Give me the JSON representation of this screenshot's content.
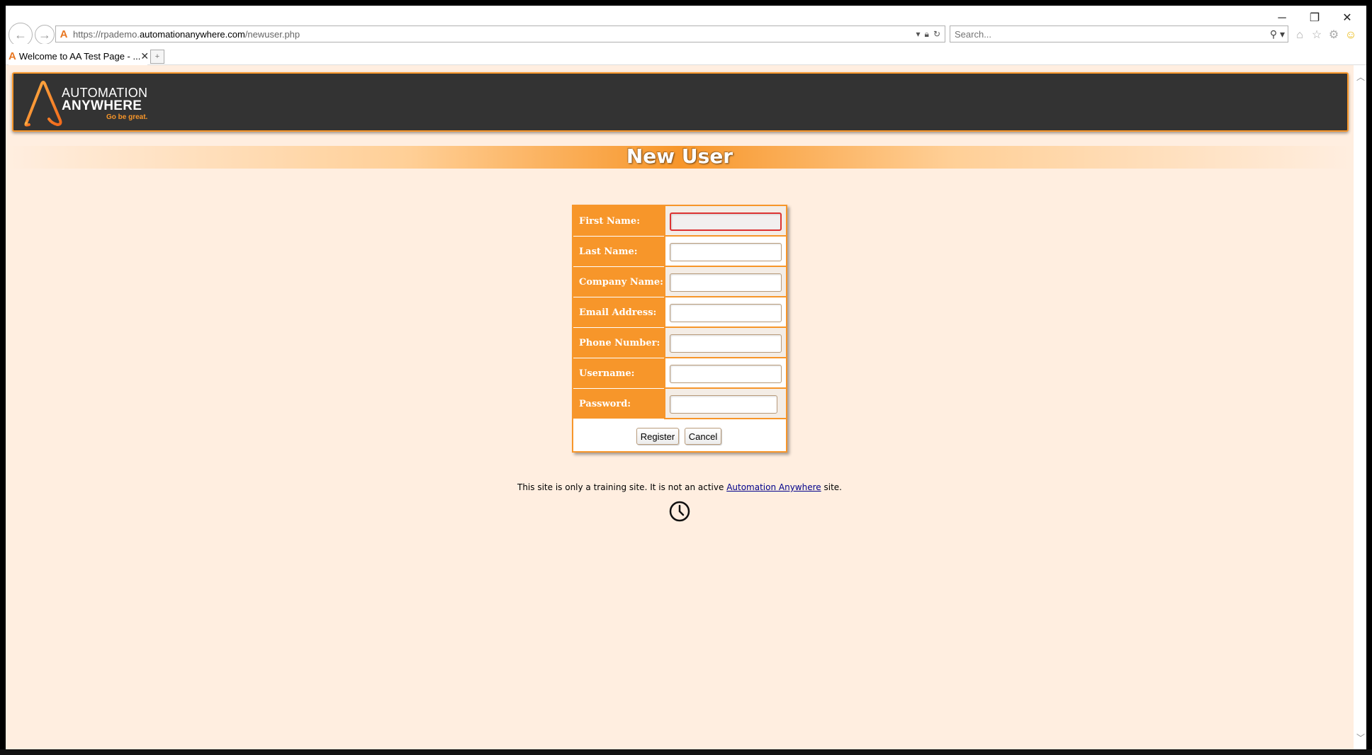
{
  "browser": {
    "url_prefix": "https://rpademo.",
    "url_domain": "automationanywhere.com",
    "url_path": "/newuser.php",
    "search_placeholder": "Search...",
    "tab_title": "Welcome to AA Test Page - ...",
    "tab_close": "✕",
    "minimize": "─",
    "restore": "❐",
    "close": "✕"
  },
  "header": {
    "logo_line1": "AUTOMATION",
    "logo_line2": "ANYWHERE",
    "logo_tagline": "Go be great."
  },
  "page": {
    "title": "New User"
  },
  "form": {
    "fields": [
      {
        "label": "First Name:",
        "value": ""
      },
      {
        "label": "Last Name:",
        "value": ""
      },
      {
        "label": "Company Name:",
        "value": ""
      },
      {
        "label": "Email Address:",
        "value": ""
      },
      {
        "label": "Phone Number:",
        "value": ""
      },
      {
        "label": "Username:",
        "value": ""
      },
      {
        "label": "Password:",
        "value": ""
      }
    ],
    "register_label": "Register",
    "cancel_label": "Cancel"
  },
  "footer": {
    "text_before": "This site is only a training site. It is not an active ",
    "link_text": "Automation Anywhere",
    "text_after": " site."
  },
  "colors": {
    "accent": "#f7962a",
    "page_bg": "#ffeee0",
    "banner_bg": "#333333",
    "link": "#00008b"
  }
}
